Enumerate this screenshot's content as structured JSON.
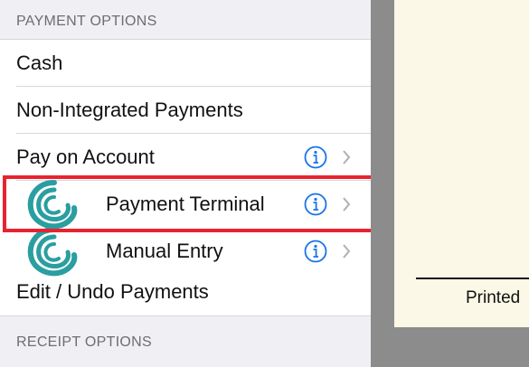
{
  "payment_options": {
    "header": "PAYMENT OPTIONS",
    "items": [
      {
        "label": "Cash"
      },
      {
        "label": "Non-Integrated Payments"
      },
      {
        "label": "Pay on Account"
      },
      {
        "label": "Payment Terminal"
      },
      {
        "label": "Manual Entry"
      },
      {
        "label": "Edit / Undo Payments"
      }
    ]
  },
  "receipt_options": {
    "header": "RECEIPT OPTIONS"
  },
  "receipt_preview": {
    "printed_text": "Printed"
  },
  "icons": {
    "info": "info-icon",
    "chevron": "chevron-right-icon",
    "terminal_logo": "swirl-logo-icon"
  },
  "colors": {
    "accent_blue": "#1a73e8",
    "logo_teal": "#2a9ea0",
    "highlight_red": "#e8232f",
    "header_bg": "#efeff4",
    "receipt_bg": "#fbf8e7"
  }
}
